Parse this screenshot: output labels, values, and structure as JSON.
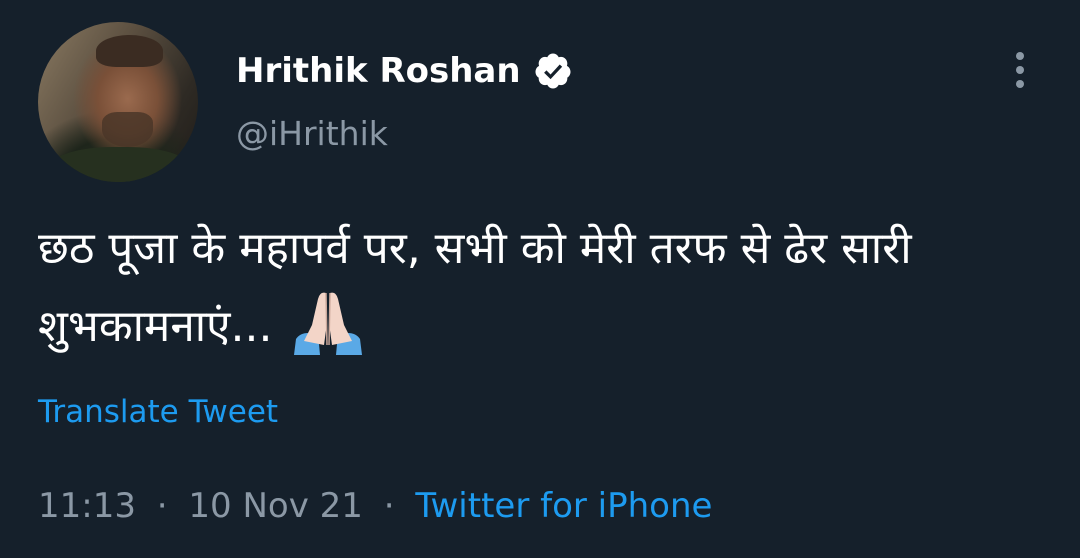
{
  "author": {
    "display_name": "Hrithik Roshan",
    "handle": "@iHrithik",
    "verified": true,
    "avatar_icon": "profile-photo"
  },
  "tweet": {
    "text": "छठ पूजा के महापर्व पर, सभी को मेरी तरफ से ढेर सारी शुभकामनाएं...",
    "emoji": "folded-hands-icon",
    "translate_label": "Translate Tweet"
  },
  "meta": {
    "time": "11:13",
    "separator": "·",
    "date": "10 Nov 21",
    "source": "Twitter for iPhone"
  },
  "colors": {
    "background": "#15202b",
    "primary_text": "#ffffff",
    "secondary_text": "#8b98a5",
    "accent": "#1d9bf0"
  }
}
